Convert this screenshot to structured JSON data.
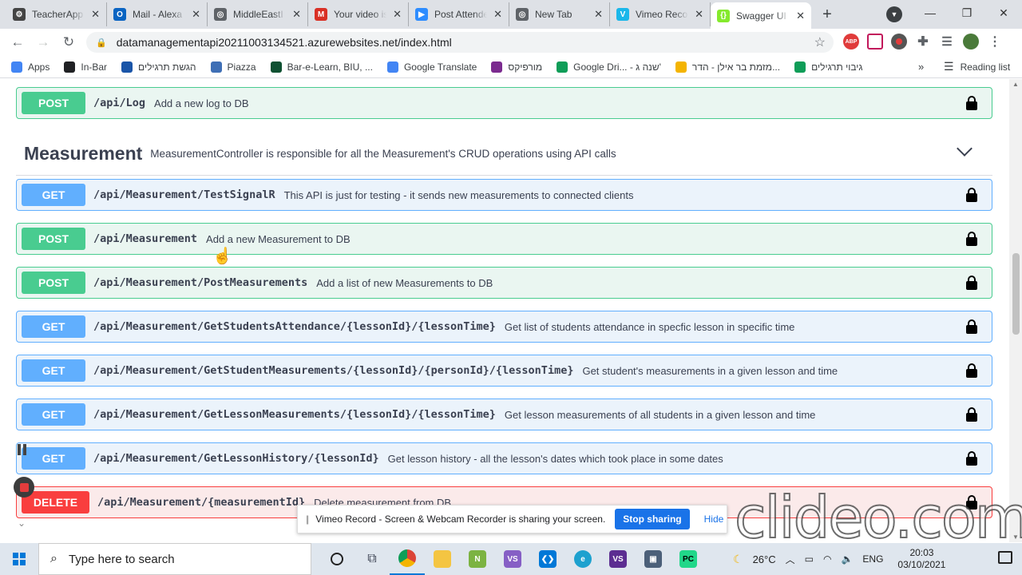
{
  "browser": {
    "tabs": [
      {
        "title": "TeacherApp",
        "icon": "gear-icon",
        "color": "#444444",
        "glyph": "⚙"
      },
      {
        "title": "Mail - Alexa",
        "icon": "outlook-icon",
        "color": "#0a64c2",
        "glyph": "O"
      },
      {
        "title": "MiddleEastI",
        "icon": "globe-icon",
        "color": "#5f6368",
        "glyph": "◎"
      },
      {
        "title": "Your video is",
        "icon": "gmail-icon",
        "color": "#d93025",
        "glyph": "M"
      },
      {
        "title": "Post Attende",
        "icon": "zoom-icon",
        "color": "#2d8cff",
        "glyph": "▶"
      },
      {
        "title": "New Tab",
        "icon": "globe-icon",
        "color": "#5f6368",
        "glyph": "◎"
      },
      {
        "title": "Vimeo Recor",
        "icon": "vimeo-icon",
        "color": "#1ab7ea",
        "glyph": "V"
      },
      {
        "title": "Swagger UI",
        "icon": "swagger-icon",
        "color": "#85ea2d",
        "glyph": "{}"
      }
    ],
    "url": "datamanagementapi20211003134521.azurewebsites.net/index.html",
    "bookmarks": [
      {
        "label": "Apps",
        "color": "#4285f4"
      },
      {
        "label": "In-Bar",
        "color": "#202124"
      },
      {
        "label": "הגשת תרגילים",
        "color": "#1a55a8"
      },
      {
        "label": "Piazza",
        "color": "#3f6fb5"
      },
      {
        "label": "Bar-e-Learn, BIU, ...",
        "color": "#0f5132"
      },
      {
        "label": "Google Translate",
        "color": "#4285f4"
      },
      {
        "label": "מורפיקס",
        "color": "#7b2b8f"
      },
      {
        "label": "Google Dri... - שנה ג'",
        "color": "#0f9d58"
      },
      {
        "label": "מזמת בר אילן - הדר...",
        "color": "#f4b400"
      },
      {
        "label": "גיבוי תרגילים",
        "color": "#0f9d58"
      }
    ],
    "bookmarks_more": "»",
    "reading_list": "Reading list"
  },
  "swagger": {
    "top_op": {
      "method": "POST",
      "path": "/api/Log",
      "desc": "Add a new log to DB"
    },
    "tag": {
      "name": "Measurement",
      "desc": "MeasurementController is responsible for all the Measurement's CRUD operations using API calls"
    },
    "ops": [
      {
        "method": "GET",
        "path": "/api/Measurement/TestSignalR",
        "desc": "This API is just for testing - it sends new measurements to connected clients"
      },
      {
        "method": "POST",
        "path": "/api/Measurement",
        "desc": "Add a new Measurement to DB"
      },
      {
        "method": "POST",
        "path": "/api/Measurement/PostMeasurements",
        "desc": "Add a list of new Measurements to DB"
      },
      {
        "method": "GET",
        "path": "/api/Measurement/GetStudentsAttendance/{lessonId}/{lessonTime}",
        "desc": "Get list of students attendance in specfic lesson in specific time"
      },
      {
        "method": "GET",
        "path": "/api/Measurement/GetStudentMeasurements/{lessonId}/{personId}/{lessonTime}",
        "desc": "Get student's measurements in a given lesson and time"
      },
      {
        "method": "GET",
        "path": "/api/Measurement/GetLessonMeasurements/{lessonId}/{lessonTime}",
        "desc": "Get lesson measurements of all students in a given lesson and time"
      },
      {
        "method": "GET",
        "path": "/api/Measurement/GetLessonHistory/{lessonId}",
        "desc": "Get lesson history - all the lesson's dates which took place in some dates"
      },
      {
        "method": "DELETE",
        "path": "/api/Measurement/{measurementId}",
        "desc": "Delete measurement from DB"
      }
    ]
  },
  "sharing": {
    "message": "Vimeo Record - Screen & Webcam Recorder is sharing your screen.",
    "stop": "Stop sharing",
    "hide": "Hide"
  },
  "watermark": "clideo.com",
  "taskbar": {
    "search_placeholder": "Type here to search",
    "weather": "26°C",
    "lang": "ENG",
    "time": "20:03",
    "date": "03/10/2021"
  }
}
